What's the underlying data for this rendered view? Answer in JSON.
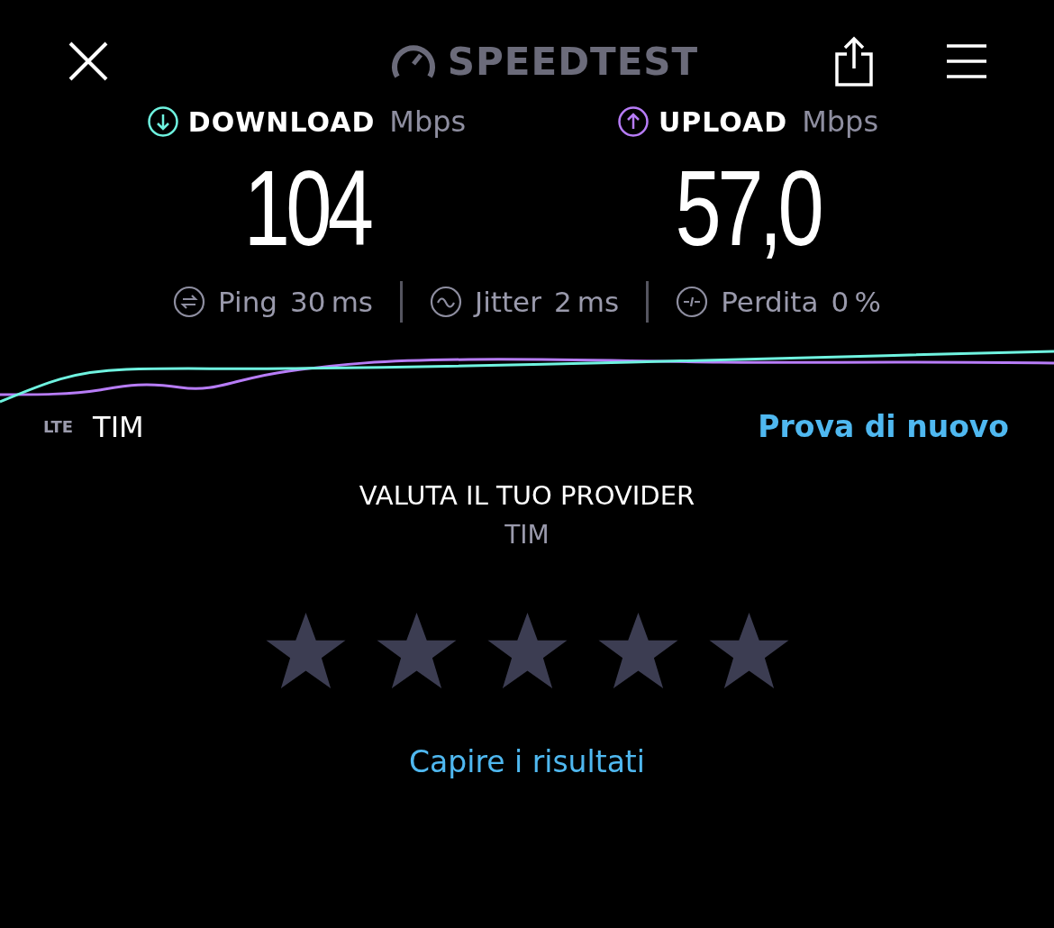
{
  "header": {
    "logo": "SPEEDTEST"
  },
  "metrics": [
    {
      "kind": "download",
      "label": "DOWNLOAD",
      "unit": "Mbps",
      "value": "104",
      "color": "#6ff3e0"
    },
    {
      "kind": "upload",
      "label": "UPLOAD",
      "unit": "Mbps",
      "value": "57,0",
      "color": "#b77cf7"
    }
  ],
  "stats": [
    {
      "kind": "ping",
      "label": "Ping",
      "value": "30",
      "unit": "ms"
    },
    {
      "kind": "jitter",
      "label": "Jitter",
      "value": "2",
      "unit": "ms"
    },
    {
      "kind": "loss",
      "label": "Perdita",
      "value": "0",
      "unit": "%"
    }
  ],
  "connection": {
    "type": "LTE",
    "provider": "TIM"
  },
  "retry_link": "Prova di nuovo",
  "rating": {
    "title": "VALUTA IL TUO PROVIDER",
    "provider": "TIM",
    "stars": 0
  },
  "results_link": "Capire i risultati"
}
